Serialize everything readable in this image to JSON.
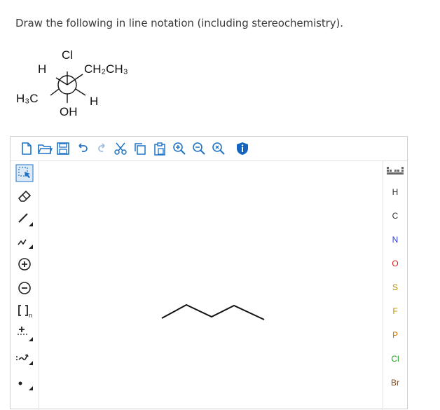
{
  "question": "Draw the following in line notation (including stereochemistry).",
  "newman": {
    "front_top": "Cl",
    "front_left": "H",
    "front_right": "CH₂CH₃",
    "back_left": "H₃C",
    "back_right": "H",
    "back_bottom": "OH"
  },
  "toolbar": {
    "icons": [
      "new-document-icon",
      "open-folder-icon",
      "save-icon",
      "undo-icon",
      "redo-icon",
      "cut-icon",
      "copy-icon",
      "paste-icon",
      "zoom-in-icon",
      "zoom-out-icon",
      "zoom-fit-icon",
      "info-icon"
    ]
  },
  "left_tools": {
    "n_label": "n"
  },
  "right_tools": {
    "elements": [
      {
        "symbol": "H",
        "color": "#333333"
      },
      {
        "symbol": "C",
        "color": "#333333"
      },
      {
        "symbol": "N",
        "color": "#2f3fd8"
      },
      {
        "symbol": "O",
        "color": "#e02020"
      },
      {
        "symbol": "S",
        "color": "#b08a00"
      },
      {
        "symbol": "F",
        "color": "#c09000"
      },
      {
        "symbol": "P",
        "color": "#d07000"
      },
      {
        "symbol": "Cl",
        "color": "#22a022"
      },
      {
        "symbol": "Br",
        "color": "#8a4a1a"
      }
    ]
  },
  "colors": {
    "accent_blue": "#1e73c8",
    "info_blue": "#1565c0"
  }
}
